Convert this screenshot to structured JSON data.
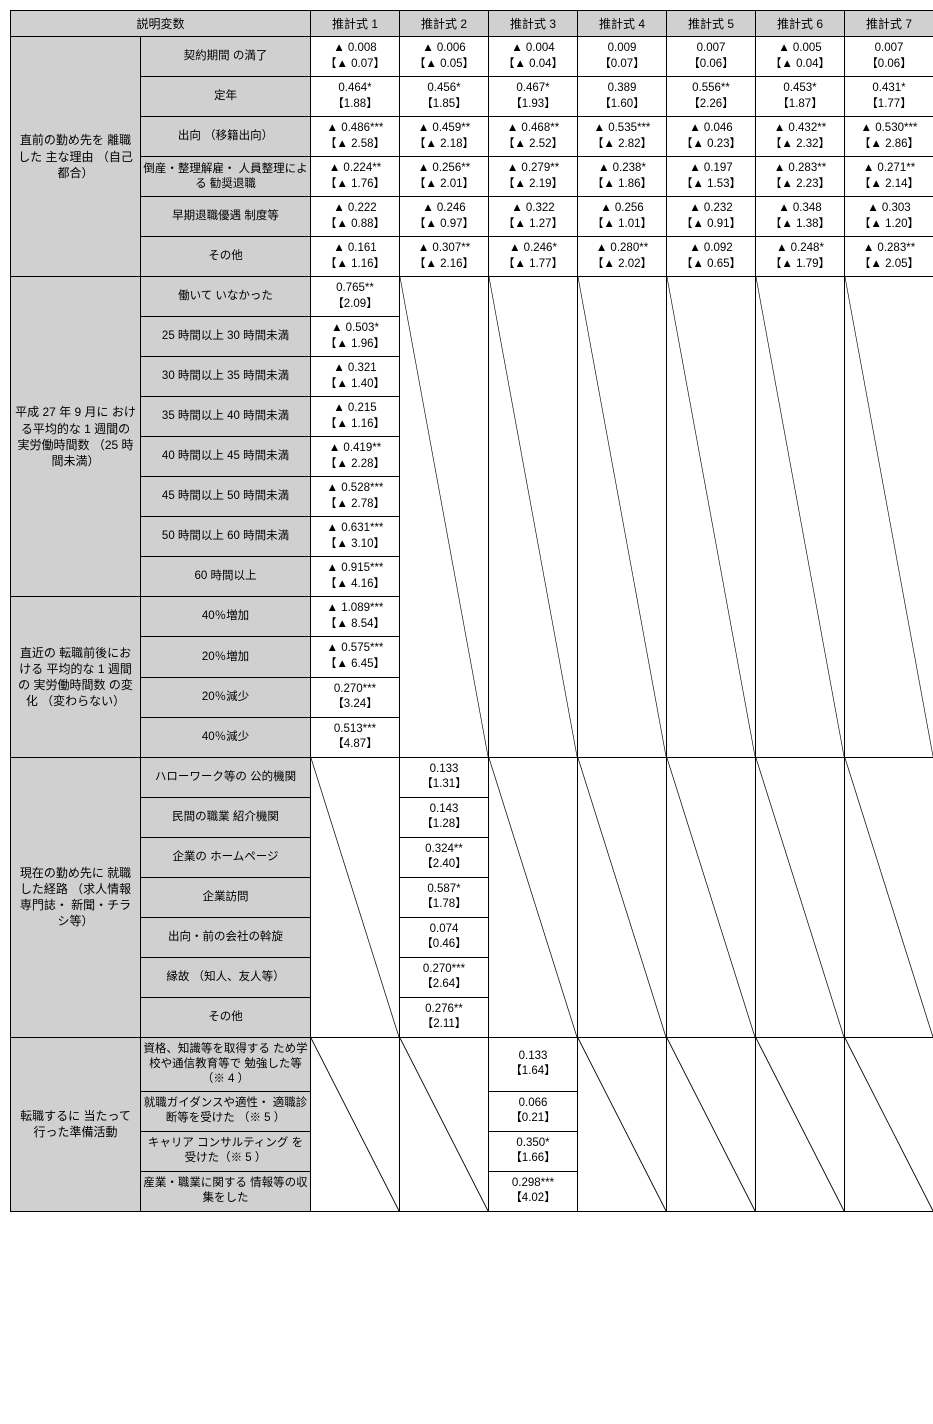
{
  "header": {
    "explanatory": "説明変数",
    "cols": [
      "推計式 1",
      "推計式 2",
      "推計式 3",
      "推計式 4",
      "推計式 5",
      "推計式 6",
      "推計式 7"
    ]
  },
  "block1": {
    "title": "直前の勤め先を\n離職した\n主な理由\n（自己都合）",
    "rows": [
      {
        "label": "契約期間\nの満了",
        "cells": [
          "▲ 0.008\n【▲ 0.07】",
          "▲ 0.006\n【▲ 0.05】",
          "▲ 0.004\n【▲ 0.04】",
          "0.009\n【0.07】",
          "0.007\n【0.06】",
          "▲ 0.005\n【▲ 0.04】",
          "0.007\n【0.06】"
        ]
      },
      {
        "label": "定年",
        "cells": [
          "0.464*\n【1.88】",
          "0.456*\n【1.85】",
          "0.467*\n【1.93】",
          "0.389\n【1.60】",
          "0.556**\n【2.26】",
          "0.453*\n【1.87】",
          "0.431*\n【1.77】"
        ]
      },
      {
        "label": "出向\n（移籍出向）",
        "cells": [
          "▲ 0.486***\n【▲ 2.58】",
          "▲ 0.459**\n【▲ 2.18】",
          "▲ 0.468**\n【▲ 2.52】",
          "▲ 0.535***\n【▲ 2.82】",
          "▲ 0.046\n【▲ 0.23】",
          "▲ 0.432**\n【▲ 2.32】",
          "▲ 0.530***\n【▲ 2.86】"
        ]
      },
      {
        "label": "倒産・整理解雇・\n人員整理による\n勧奨退職",
        "cells": [
          "▲ 0.224**\n【▲ 1.76】",
          "▲ 0.256**\n【▲ 2.01】",
          "▲ 0.279**\n【▲ 2.19】",
          "▲ 0.238*\n【▲ 1.86】",
          "▲ 0.197\n【▲ 1.53】",
          "▲ 0.283**\n【▲ 2.23】",
          "▲ 0.271**\n【▲ 2.14】"
        ]
      },
      {
        "label": "早期退職優遇\n制度等",
        "cells": [
          "▲ 0.222\n【▲ 0.88】",
          "▲ 0.246\n【▲ 0.97】",
          "▲ 0.322\n【▲ 1.27】",
          "▲ 0.256\n【▲ 1.01】",
          "▲ 0.232\n【▲ 0.91】",
          "▲ 0.348\n【▲ 1.38】",
          "▲ 0.303\n【▲ 1.20】"
        ]
      },
      {
        "label": "その他",
        "cells": [
          "▲ 0.161\n【▲ 1.16】",
          "▲ 0.307**\n【▲ 2.16】",
          "▲ 0.246*\n【▲ 1.77】",
          "▲ 0.280**\n【▲ 2.02】",
          "▲ 0.092\n【▲ 0.65】",
          "▲ 0.248*\n【▲ 1.79】",
          "▲ 0.283**\n【▲ 2.05】"
        ]
      }
    ]
  },
  "block2": {
    "title": "平成 27 年 9 月に\nおける平均的な\n1 週間の\n実労働時間数\n（25 時間未満）",
    "rows": [
      {
        "label": "働いて\nいなかった",
        "cell": "0.765**\n【2.09】"
      },
      {
        "label": "25 時間以上\n30 時間未満",
        "cell": "▲ 0.503*\n【▲ 1.96】"
      },
      {
        "label": "30 時間以上\n35 時間未満",
        "cell": "▲ 0.321\n【▲ 1.40】"
      },
      {
        "label": "35 時間以上\n40 時間未満",
        "cell": "▲ 0.215\n【▲ 1.16】"
      },
      {
        "label": "40 時間以上\n45 時間未満",
        "cell": "▲ 0.419**\n【▲ 2.28】"
      },
      {
        "label": "45 時間以上\n50 時間未満",
        "cell": "▲ 0.528***\n【▲ 2.78】"
      },
      {
        "label": "50 時間以上\n60 時間未満",
        "cell": "▲ 0.631***\n【▲ 3.10】"
      },
      {
        "label": "60 時間以上",
        "cell": "▲ 0.915***\n【▲ 4.16】"
      }
    ]
  },
  "block3": {
    "title": "直近の\n転職前後における\n平均的な 1 週間の\n実労働時間数\nの変化\n（変わらない）",
    "rows": [
      {
        "label": "40％増加",
        "cell": "▲ 1.089***\n【▲ 8.54】"
      },
      {
        "label": "20％増加",
        "cell": "▲ 0.575***\n【▲ 6.45】"
      },
      {
        "label": "20％減少",
        "cell": "0.270***\n【3.24】"
      },
      {
        "label": "40％減少",
        "cell": "0.513***\n【4.87】"
      }
    ]
  },
  "block4": {
    "title": "現在の勤め先に\n就職した経路\n（求人情報専門誌・\n新聞・チラシ等）",
    "rows": [
      {
        "label": "ハローワーク等の\n公的機関",
        "cell": "0.133\n【1.31】"
      },
      {
        "label": "民間の職業\n紹介機関",
        "cell": "0.143\n【1.28】"
      },
      {
        "label": "企業の\nホームページ",
        "cell": "0.324**\n【2.40】"
      },
      {
        "label": "企業訪問",
        "cell": "0.587*\n【1.78】"
      },
      {
        "label": "出向・前の会社の斡旋",
        "cell": "0.074\n【0.46】"
      },
      {
        "label": "縁故\n（知人、友人等）",
        "cell": "0.270***\n【2.64】"
      },
      {
        "label": "その他",
        "cell": "0.276**\n【2.11】"
      }
    ]
  },
  "block5": {
    "title": "転職するに\n当たって\n行った準備活動",
    "rows": [
      {
        "label": "資格、知識等を取得する\nため学校や通信教育等で\n勉強した等（※ 4 ）",
        "cell": "0.133\n【1.64】"
      },
      {
        "label": "就職ガイダンスや適性・\n適職診断等を受けた\n（※ 5 ）",
        "cell": "0.066\n【0.21】"
      },
      {
        "label": "キャリア\nコンサルティング\nを受けた（※ 5 ）",
        "cell": "0.350*\n【1.66】"
      },
      {
        "label": "産業・職業に関する\n情報等の収集をした",
        "cell": "0.298***\n【4.02】"
      }
    ]
  }
}
